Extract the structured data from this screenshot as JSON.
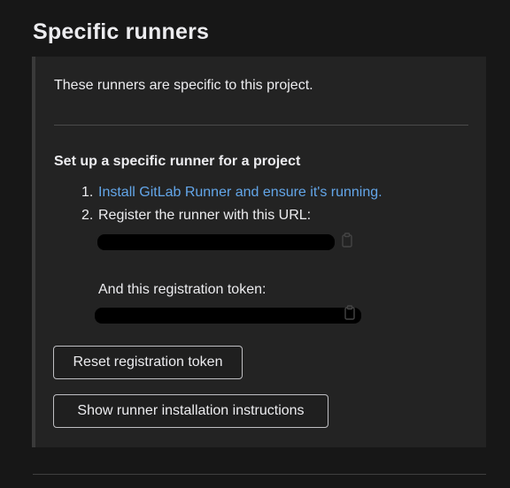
{
  "section": {
    "title": "Specific runners"
  },
  "panel": {
    "intro": "These runners are specific to this project.",
    "setup_heading": "Set up a specific runner for a project",
    "steps": [
      {
        "number": "1.",
        "text": "Install GitLab Runner and ensure it's running."
      },
      {
        "number": "2.",
        "text": "Register the runner with this URL:"
      }
    ],
    "token_label": "And this registration token:",
    "copy_icon": "clipboard-icon",
    "link_color": "#63a6e9"
  },
  "buttons": {
    "reset_token": "Reset registration token",
    "show_instructions": "Show runner installation instructions"
  }
}
